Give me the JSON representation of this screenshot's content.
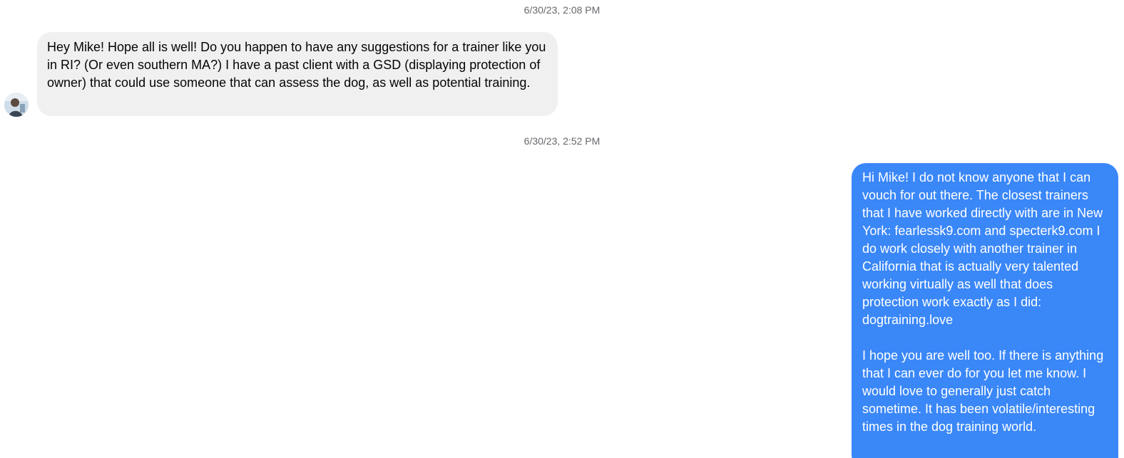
{
  "thread": {
    "messages": [
      {
        "timestamp": "6/30/23, 2:08 PM",
        "direction": "incoming",
        "avatar_icon": "profile-photo",
        "text": "Hey Mike! Hope all is well! Do you happen to have any suggestions for a trainer like you in RI? (Or even southern MA?) I have a past client with a GSD (displaying protection of owner) that could use someone that can assess the dog, as well as potential training."
      },
      {
        "timestamp": "6/30/23, 2:52 PM",
        "direction": "outgoing",
        "text": "Hi Mike! I do not know anyone that I can vouch for out there.  The closest trainers that I have worked directly with are in New York:  fearlessk9.com and specterk9.com   I do work closely with another trainer in California that is actually very talented working virtually as well that does protection work exactly as I did: dogtraining.love\n\nI hope you are well too.  If there is anything that I can ever do for you let me know.  I would love to generally just catch sometime.  It has been volatile/interesting times in the dog training world."
      }
    ]
  },
  "colors": {
    "incoming_bubble": "#f0f0f0",
    "outgoing_bubble": "#3a87f8",
    "timestamp_text": "#65676b"
  }
}
